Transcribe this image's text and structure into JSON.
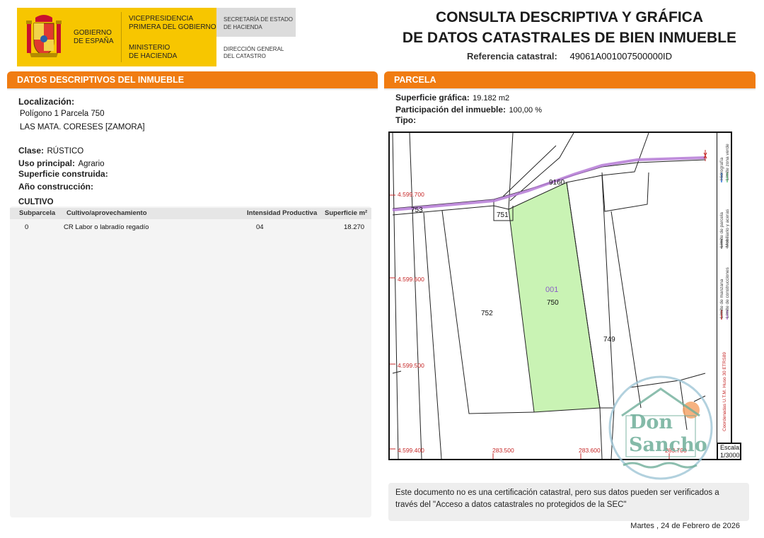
{
  "header": {
    "gov_name_line1": "GOBIERNO",
    "gov_name_line2": "DE ESPAÑA",
    "vice_line1": "VICEPRESIDENCIA",
    "vice_line2": "PRIMERA DEL GOBIERNO",
    "min_line1": "MINISTERIO",
    "min_line2": "DE HACIENDA",
    "sec_line1": "SECRETARÍA DE ESTADO",
    "sec_line2": "DE HACIENDA",
    "dg_line1": "DIRECCIÓN GENERAL",
    "dg_line2": "DEL CATASTRO",
    "title_line1": "CONSULTA DESCRIPTIVA Y GRÁFICA",
    "title_line2": "DE DATOS CATASTRALES DE BIEN INMUEBLE",
    "ref_label": "Referencia catastral:",
    "ref_value": "49061A001007500000ID"
  },
  "left_section": {
    "header": "DATOS DESCRIPTIVOS DEL INMUEBLE",
    "localizacion_label": "Localización:",
    "localizacion_line1": "Polígono 1 Parcela 750",
    "localizacion_line2": "LAS MATA. CORESES [ZAMORA]",
    "clase_label": "Clase:",
    "clase_value": "RÚSTICO",
    "uso_label": "Uso principal:",
    "uso_value": "Agrario",
    "superficie_label": "Superficie construida:",
    "anio_label": "Año construcción:",
    "cultivo_label": "CULTIVO",
    "cultivo_columns": [
      "Subparcela",
      "Cultivo/aprovechamiento",
      "Intensidad Productiva",
      "Superficie m²"
    ],
    "cultivo_rows": [
      {
        "subparcela": "0",
        "cultivo": "CR Labor o labradío regadío",
        "intensidad": "04",
        "superficie": "18.270"
      }
    ]
  },
  "right_section": {
    "header": "PARCELA",
    "sup_grafica_label": "Superficie gráfica:",
    "sup_grafica_value": "19.182 m2",
    "participacion_label": "Participación del inmueble:",
    "participacion_value": "100,00 %",
    "tipo_label": "Tipo:"
  },
  "map": {
    "y_labels": [
      "4.599.700",
      "4.599.600",
      "4.599.500",
      "4.599.400"
    ],
    "x_labels": [
      "283.500",
      "283.600",
      "283.700"
    ],
    "parcel_labels": [
      "753",
      "751",
      "9160",
      "752",
      "750",
      "001",
      "749"
    ],
    "legend_items": [
      "Hidrografía",
      "Límite zona verde",
      "Límite de parcela",
      "Mobiliario y aceras",
      "Límite de manzana",
      "Límite de construcciones"
    ],
    "coord_note": "Coordenadas U.T.M. Huso 30 ETRS89",
    "scale_label": "Escala:",
    "scale_value": "1/3000",
    "parcel_color": "#c9f3b4",
    "grid_label_color": "#c62828",
    "hydro_color": "#b57ad6"
  },
  "notice_line1": "Este documento no es una certificación catastral, pero sus datos pueden ser verificados a",
  "notice_line2": "través del \"Acceso a datos catastrales no protegidos de la SEC\"",
  "date": "Martes , 24 de Febrero de 2026",
  "watermark_text_1": "Don",
  "watermark_text_2": "Sancho"
}
